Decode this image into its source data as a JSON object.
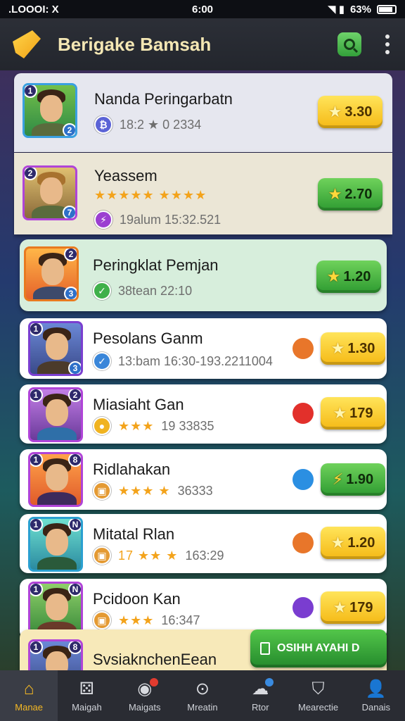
{
  "status_bar": {
    "left": ".LOOOI: X",
    "time": "6:00",
    "battery": "63%"
  },
  "app_bar": {
    "title": "Berigake Bamsah"
  },
  "rows": [
    {
      "name": "Nanda Peringarbatn",
      "meta": "18:2 ★  0 2334",
      "score": "3.30",
      "badge_a": "1",
      "badge_b": "2",
      "coin_color": "#5b63d6",
      "btn": "gold"
    },
    {
      "name": "Yeassem",
      "meta": "19alum  15:32.521",
      "stars": "★★★★★ ★★★★",
      "score": "2.70",
      "badge_a": "2",
      "badge_b": "7",
      "coin_color": "#9b3fd1",
      "btn": "green"
    },
    {
      "name": "Peringklat Pemjan",
      "meta": "38tean  22:10",
      "score": "1.20",
      "badge_a": "2",
      "badge_b": "3",
      "coin_color": "#3fb04a",
      "btn": "green"
    },
    {
      "name": "Pesolans Ganm",
      "meta": "13:bam  16:30-193.2211004",
      "score": "1.30",
      "badge_a": "1",
      "badge_b": "3",
      "coin_color": "#3a86d9",
      "btn": "gold",
      "gem": "#e8762a"
    },
    {
      "name": "Miasiaht Gan",
      "meta": "19 33835",
      "stars": "★★★",
      "score": "179",
      "badge_a": "1",
      "badge_b": "2",
      "coin_color": "#f0b320",
      "btn": "gold",
      "gem": "#e2302b"
    },
    {
      "name": "Ridlahakan",
      "meta": "36333",
      "stars": "★★★  ★",
      "score": "1.90",
      "badge_a": "1",
      "badge_b": "8",
      "coin_color": "#e49a33",
      "btn": "green",
      "gem": "#2b8fe2"
    },
    {
      "name": "Mitatal Rlan",
      "meta": "163:29",
      "stars": "17 ★★  ★",
      "score": "1.20",
      "badge_a": "1",
      "badge_b": "N",
      "coin_color": "#e49a33",
      "btn": "gold",
      "gem": "#e8762a"
    },
    {
      "name": "Pcidoon Kan",
      "meta": "16:347",
      "stars": "★★★",
      "score": "179",
      "badge_a": "1",
      "badge_b": "N",
      "coin_color": "#e49a33",
      "btn": "gold",
      "gem": "#7a3dd0"
    },
    {
      "name": "SvsiaknchenEean",
      "badge_a": "1",
      "badge_b": "8"
    }
  ],
  "cta": {
    "label": "OSIHH AYAHI D"
  },
  "bottom_nav": [
    {
      "label": "Manae",
      "icon": "home-icon",
      "active": true
    },
    {
      "label": "Maigah",
      "icon": "dice-icon"
    },
    {
      "label": "Maigats",
      "icon": "target-icon",
      "dot": "#e23b2f"
    },
    {
      "label": "Mreatin",
      "icon": "download-icon"
    },
    {
      "label": "Rtor",
      "icon": "cloud-icon",
      "dot": "#3a8be0"
    },
    {
      "label": "Mearectie",
      "icon": "shield-icon"
    },
    {
      "label": "Danais",
      "icon": "person-icon"
    }
  ]
}
